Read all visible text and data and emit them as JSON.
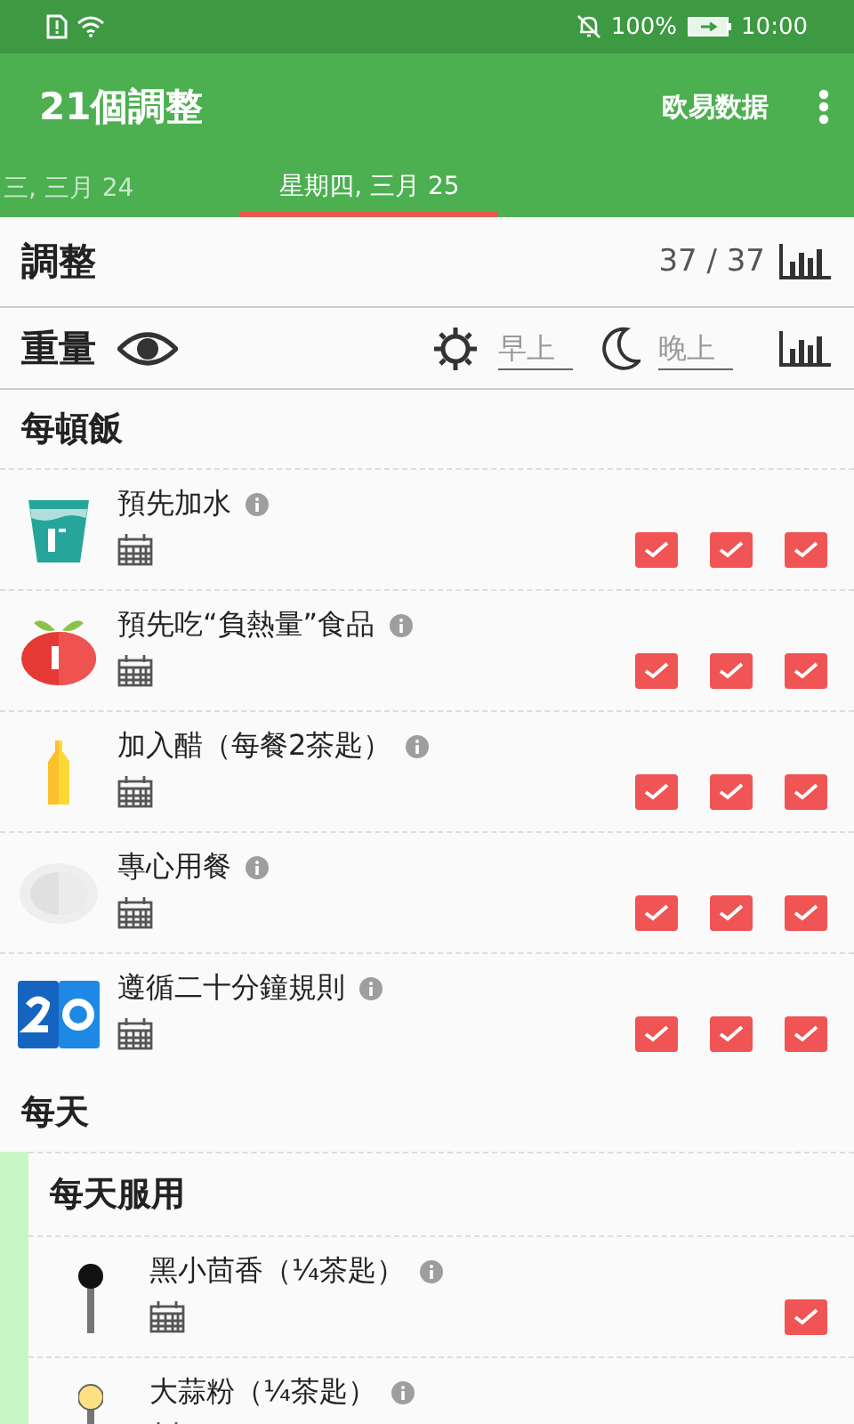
{
  "status_bar": {
    "battery": "100%",
    "time": "10:00"
  },
  "app_bar": {
    "title": "21個調整",
    "action": "欧易数据"
  },
  "date_tabs": [
    {
      "label": "三, 三月 24",
      "selected": false
    },
    {
      "label": "星期四, 三月 25",
      "selected": true
    }
  ],
  "summary": {
    "label": "調整",
    "count": "37 / 37"
  },
  "weight": {
    "label": "重量",
    "morning": {
      "placeholder": "早上"
    },
    "evening": {
      "placeholder": "晚上"
    }
  },
  "sections": [
    {
      "title": "每頓飯",
      "items": [
        {
          "name": "預先加水",
          "checks": [
            true,
            true,
            true
          ]
        },
        {
          "name": "預先吃“負熱量”食品",
          "checks": [
            true,
            true,
            true
          ]
        },
        {
          "name": "加入醋（每餐2茶匙）",
          "checks": [
            true,
            true,
            true
          ]
        },
        {
          "name": "專心用餐",
          "checks": [
            true,
            true,
            true
          ]
        },
        {
          "name": "遵循二十分鐘規則",
          "checks": [
            true,
            true,
            true
          ]
        }
      ]
    },
    {
      "title": "每天",
      "groups": [
        {
          "title": "每天服用",
          "items": [
            {
              "name": "黑小茴香（¼茶匙）",
              "checks": [
                true
              ]
            },
            {
              "name": "大蒜粉（¼茶匙）"
            }
          ]
        }
      ]
    }
  ]
}
